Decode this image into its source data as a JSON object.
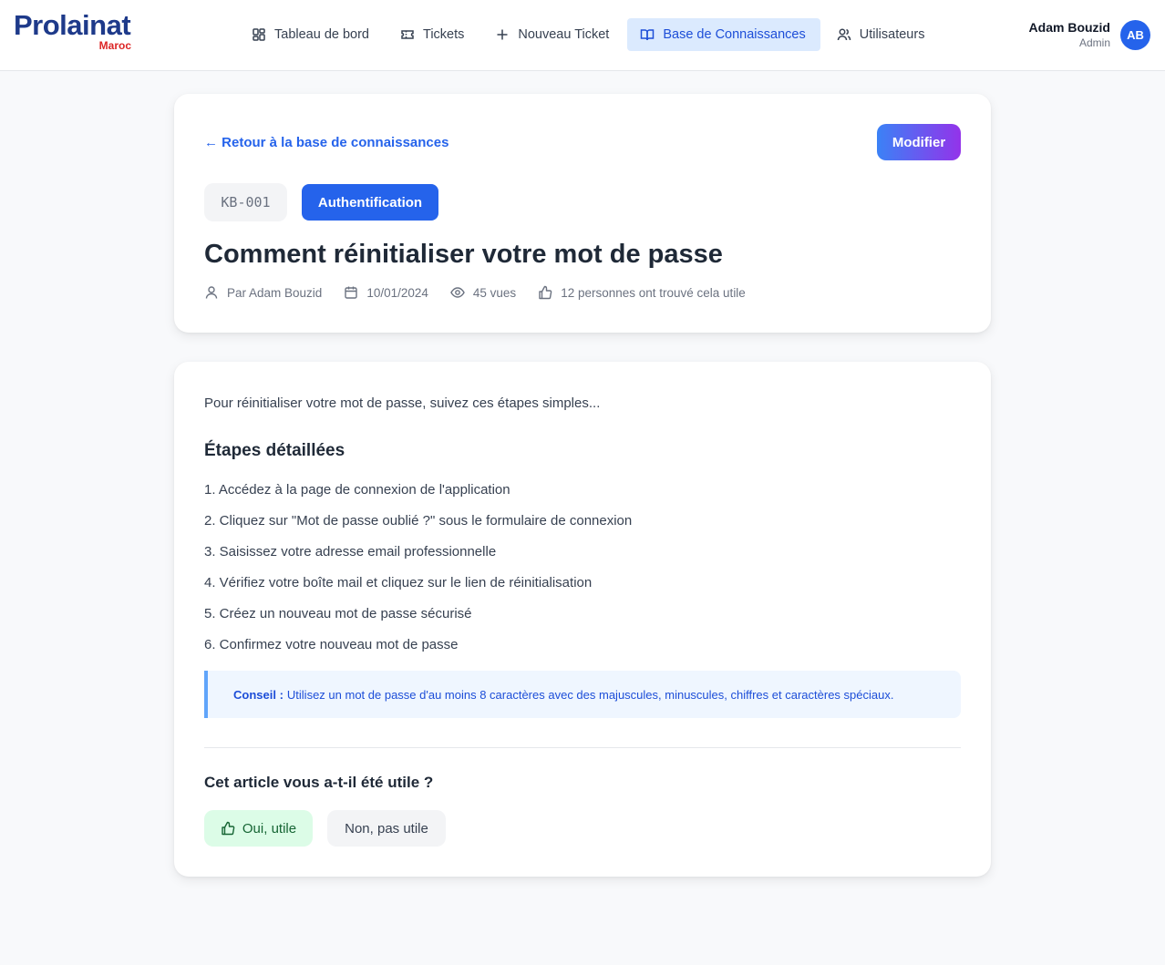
{
  "brand": {
    "name": "Prolainat",
    "subtitle": "Maroc"
  },
  "nav": {
    "items": [
      {
        "label": "Tableau de bord",
        "icon": "dashboard-icon"
      },
      {
        "label": "Tickets",
        "icon": "ticket-icon"
      },
      {
        "label": "Nouveau Ticket",
        "icon": "plus-icon"
      },
      {
        "label": "Base de Connaissances",
        "icon": "book-icon",
        "active": true
      },
      {
        "label": "Utilisateurs",
        "icon": "users-icon"
      }
    ]
  },
  "user": {
    "name": "Adam Bouzid",
    "role": "Admin",
    "initials": "AB"
  },
  "article": {
    "back_label": "← Retour à la base de connaissances",
    "edit_label": "Modifier",
    "id": "KB-001",
    "category": "Authentification",
    "title": "Comment réinitialiser votre mot de passe",
    "meta": {
      "author": "Par Adam Bouzid",
      "date": "10/01/2024",
      "views": "45 vues",
      "helpful": "12 personnes ont trouvé cela utile"
    },
    "intro": "Pour réinitialiser votre mot de passe, suivez ces étapes simples...",
    "steps_heading": "Étapes détaillées",
    "steps": [
      "1. Accédez à la page de connexion de l'application",
      "2. Cliquez sur \"Mot de passe oublié ?\" sous le formulaire de connexion",
      "3. Saisissez votre adresse email professionnelle",
      "4. Vérifiez votre boîte mail et cliquez sur le lien de réinitialisation",
      "5. Créez un nouveau mot de passe sécurisé",
      "6. Confirmez votre nouveau mot de passe"
    ],
    "tip_label": "Conseil :",
    "tip_text": "Utilisez un mot de passe d'au moins 8 caractères avec des majuscules, minuscules, chiffres et caractères spéciaux."
  },
  "feedback": {
    "question": "Cet article vous a-t-il été utile ?",
    "yes_label": "Oui, utile",
    "no_label": "Non, pas utile"
  },
  "colors": {
    "accent": "#2563eb",
    "brand": "#1e3a8a",
    "brand_sub": "#dc2626",
    "success_bg": "#dcfce7"
  }
}
